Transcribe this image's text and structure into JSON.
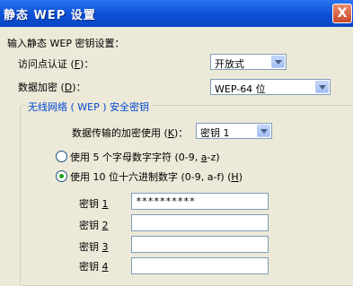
{
  "window": {
    "title": "静态 WEP 设置",
    "close_label": "X"
  },
  "form": {
    "section_label": "输入静态 WEP 密钥设置：",
    "auth": {
      "label": "访问点认证",
      "accel": "F",
      "value": "开放式"
    },
    "encryption": {
      "label": "数据加密",
      "accel": "D",
      "value": "WEP-64 位"
    }
  },
  "group": {
    "title": "无线网络 ( WEP ) 安全密钥",
    "key_in_use": {
      "label": "数据传输的加密使用",
      "accel": "K",
      "value": "密钥 1"
    },
    "radio_ascii": {
      "text_before": "使用 5 个字母数字字符 (0-9, ",
      "accel": "a",
      "text_after": "-z)",
      "checked": false
    },
    "radio_hex": {
      "text": "使用 10 位十六进制数字 (0-9, a-f)",
      "accel": "H",
      "checked": true
    },
    "keys": [
      {
        "label": "密钥",
        "num": "1",
        "value": "**********"
      },
      {
        "label": "密钥",
        "num": "2",
        "value": ""
      },
      {
        "label": "密钥",
        "num": "3",
        "value": ""
      },
      {
        "label": "密钥",
        "num": "4",
        "value": ""
      }
    ]
  }
}
